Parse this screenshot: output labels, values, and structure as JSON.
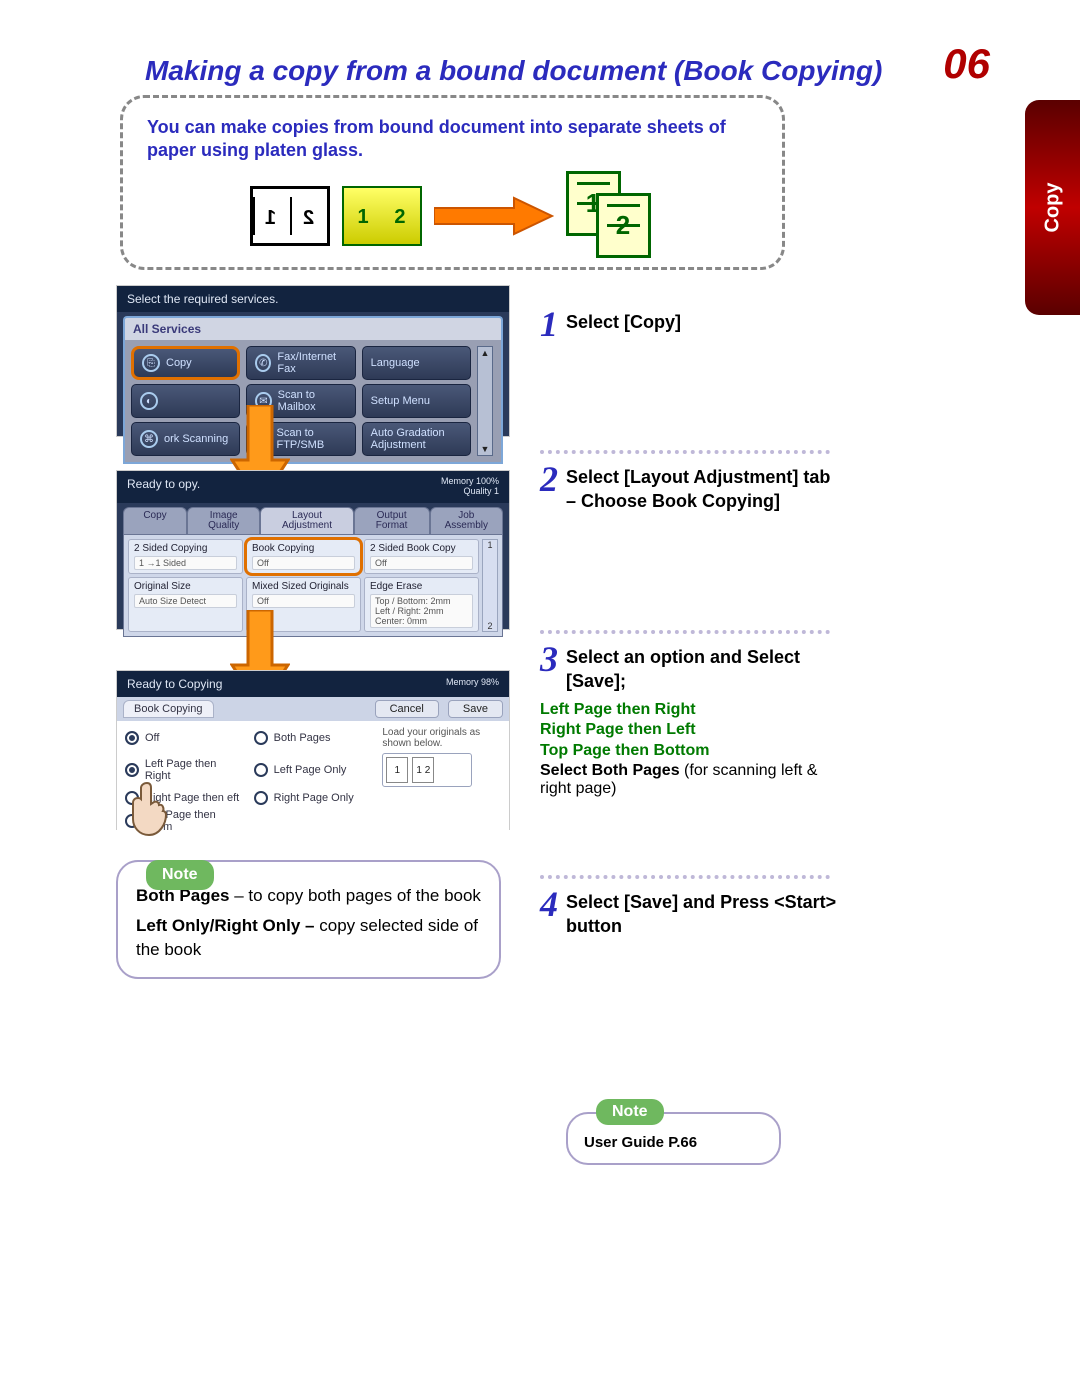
{
  "page": {
    "title": "Making a copy from a bound document (Book Copying)",
    "number": "06",
    "side_tab": "Copy"
  },
  "intro": {
    "text": "You can make copies from bound document into separate sheets of paper using platen glass."
  },
  "screenshot1": {
    "prompt": "Select the required services.",
    "tab": "All Services",
    "buttons": {
      "copy": "Copy",
      "fax": "Fax/Internet Fax",
      "language": "Language",
      "b4": "",
      "mailbox": "Scan to Mailbox",
      "setup": "Setup Menu",
      "network": "ork Scanning",
      "ftp": "Scan to FTP/SMB",
      "gradation": "Auto Gradation Adjustment"
    }
  },
  "screenshot2": {
    "status_left": "Ready to   opy.",
    "status_right_top": "Memory 100%",
    "status_right_bottom": "Quality   1",
    "tabs": {
      "t1": "Copy",
      "t2": "Image Quality",
      "t3": "Layout Adjustment",
      "t4": "Output Format",
      "t5": "Job Assembly"
    },
    "cells": {
      "c1_title": "2 Sided Copying",
      "c1_sub": "1 →1 Sided",
      "c2_title": "Book Copying",
      "c2_sub": "Off",
      "c3_title": "2 Sided Book Copy",
      "c3_sub": "Off",
      "c4_title": "Original Size",
      "c4_sub": "Auto Size Detect",
      "c5_title": "Mixed Sized Originals",
      "c5_sub": "Off",
      "c6_title": "Edge Erase",
      "c6_sub": "Top / Bottom: 2mm\nLeft / Right: 2mm\nCenter: 0mm"
    },
    "scroll": {
      "top": "1",
      "bottom": "2"
    }
  },
  "screenshot3": {
    "status_left": "Ready to Copying",
    "status_right": "Memory 98%",
    "tab": "Book Copying",
    "cancel": "Cancel",
    "save": "Save",
    "radios": {
      "off": "Off",
      "both": "Both Pages",
      "lpr": "Left Page then Right",
      "lpo": "Left Page Only",
      "rpl": "Right Page then eft",
      "rpo": "Right Page Only",
      "tpb": "Top Page then ottom"
    },
    "msg": "Load your originals as shown below."
  },
  "steps": {
    "s1": {
      "num": "1",
      "text": "Select [Copy]"
    },
    "s2": {
      "num": "2",
      "text": "Select [Layout Adjustment] tab – Choose Book Copying]"
    },
    "s3": {
      "num": "3",
      "text": "Select an option and Select [Save];",
      "opt1": "Left Page then Right",
      "opt2": "Right Page then Left",
      "opt3": "Top Page then Bottom",
      "both_bold": "Select Both Pages",
      "both_rest": " (for scanning left & right page)"
    },
    "s4": {
      "num": "4",
      "text": "Select [Save] and Press <Start> button"
    }
  },
  "notes": {
    "n1": {
      "label": "Note",
      "bp_bold": "Both Pages",
      "bp_rest": " – to copy both pages of the book",
      "lr_bold": "Left Only/Right Only –",
      "lr_rest": " copy selected side of the book"
    },
    "n2": {
      "label": "Note",
      "text": "User Guide P.66"
    }
  }
}
